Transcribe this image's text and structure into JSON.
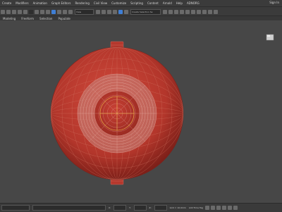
{
  "menubar": {
    "items": [
      "Create",
      "Modifiers",
      "Animation",
      "Graph Editors",
      "Rendering",
      "Civil View",
      "Customize",
      "Scripting",
      "Content",
      "Arnold",
      "Help",
      "ADNORG"
    ],
    "signin": "Sign In"
  },
  "toolbar": {
    "view_label": "View",
    "selection_set_placeholder": "Create Selection Se"
  },
  "ribbon": {
    "tabs": [
      "Modeling",
      "Freeform",
      "Selection",
      "Populate"
    ]
  },
  "statusbar": {
    "x_label": "X:",
    "y_label": "Y:",
    "z_label": "Z:",
    "grid": "Grid = 10.0mm",
    "time_tag": "Add Time Tag"
  },
  "colors": {
    "sphere": "#b83a2f",
    "wire": "#d07262",
    "active_blue": "#3f7fd6"
  }
}
